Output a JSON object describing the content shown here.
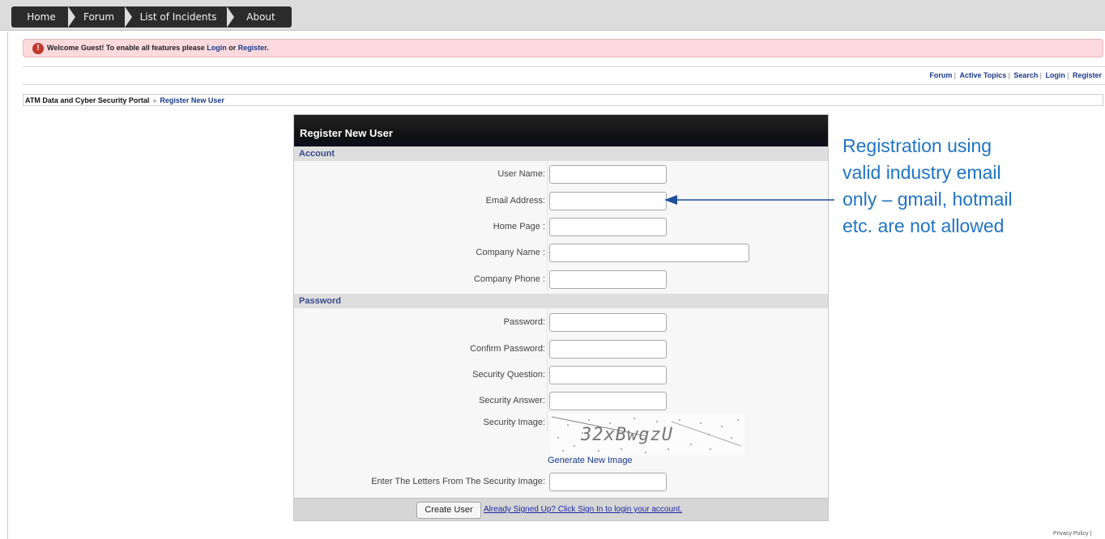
{
  "nav": {
    "tabs": [
      {
        "label": "Home"
      },
      {
        "label": "Forum"
      },
      {
        "label": "List of Incidents"
      },
      {
        "label": "About"
      }
    ]
  },
  "welcome": {
    "prefix": "Welcome Guest! To enable all features please ",
    "login": "Login",
    "or": " or ",
    "register": "Register",
    "suffix": ".",
    "icon": "alert-icon"
  },
  "forum_links": [
    "Forum",
    "Active Topics",
    "Search",
    "Login",
    "Register"
  ],
  "breadcrumb": {
    "root": "ATM Data and Cyber Security Portal",
    "separator": "»",
    "current": "Register New User"
  },
  "form": {
    "title": "Register New User",
    "account_section": "Account",
    "password_section": "Password",
    "fields": {
      "user_name": "User Name:",
      "email": "Email Address:",
      "home_page": "Home Page :",
      "company_name": "Company Name :",
      "company_phone": "Company Phone :",
      "password": "Password:",
      "confirm_password": "Confirm Password:",
      "security_question": "Security Question:",
      "security_answer": "Security Answer:",
      "security_image": "Security Image:",
      "captcha_entry": "Enter The Letters From The Security Image:"
    },
    "captcha_text": "32xBwgzU",
    "generate_link": "Generate New Image",
    "create_button": "Create User",
    "signed_up_link": "Already Signed Up? Click Sign In to login your account."
  },
  "annotation": {
    "lines": [
      "Registration using",
      "valid industry email",
      "only – gmail, hotmail",
      "etc. are not allowed"
    ],
    "color": "#1f74c4"
  },
  "footer": {
    "privacy": "Privacy Policy |"
  }
}
